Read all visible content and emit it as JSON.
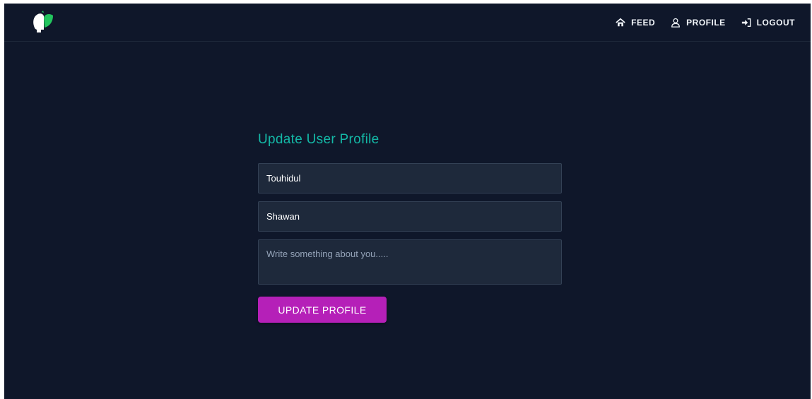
{
  "navbar": {
    "logo_icon": "leaf-head-logo",
    "links": [
      {
        "label": "FEED",
        "icon": "home-icon"
      },
      {
        "label": "PROFILE",
        "icon": "user-icon"
      },
      {
        "label": "LOGOUT",
        "icon": "logout-icon"
      }
    ]
  },
  "form": {
    "title": "Update User Profile",
    "first_name_value": "Touhidul",
    "last_name_value": "Shawan",
    "bio_placeholder": "Write something about you.....",
    "submit_label": "UPDATE PROFILE"
  },
  "colors": {
    "background": "#0f172a",
    "title": "#14b8a6",
    "input_bg": "#1e293b",
    "button": "#b520b8"
  }
}
